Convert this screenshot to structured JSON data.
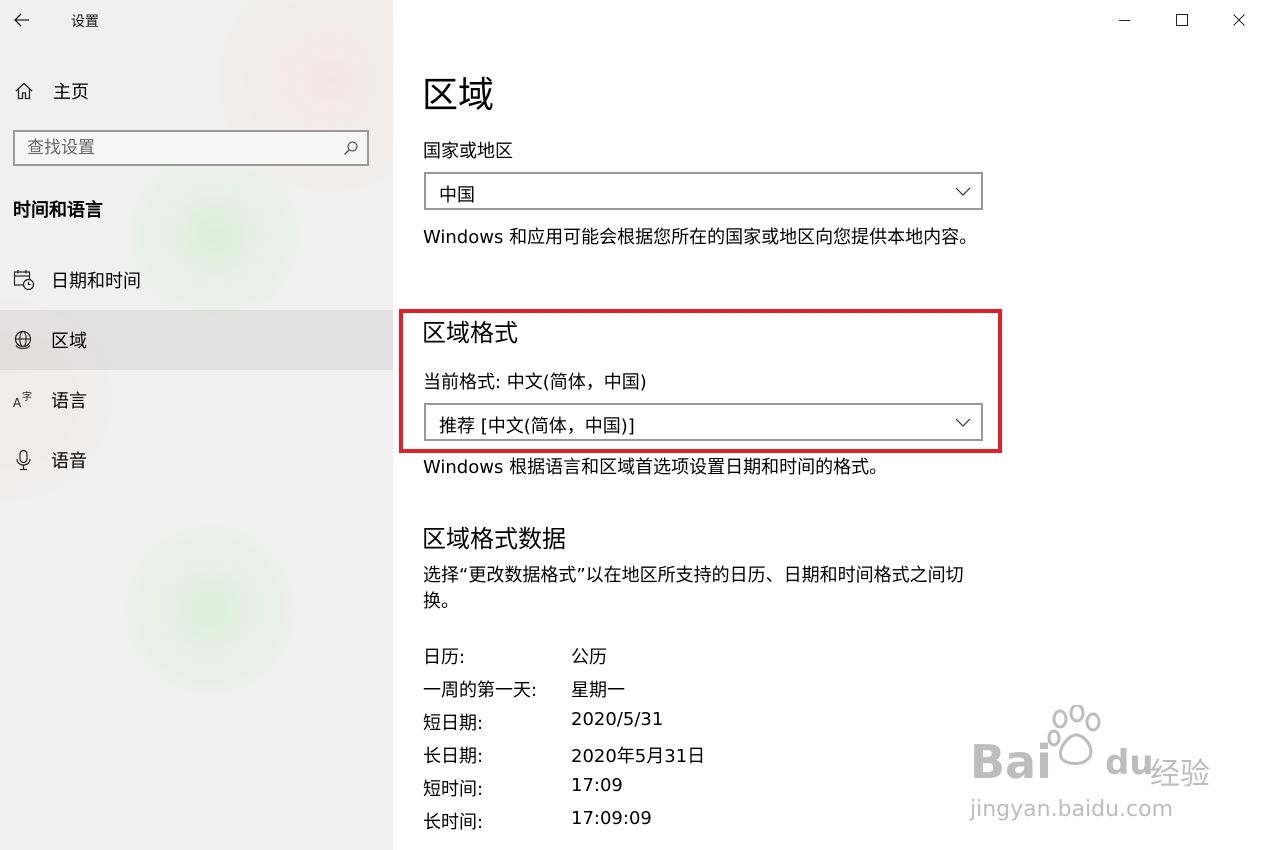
{
  "window": {
    "title": "设置",
    "controls": [
      "minimize-icon",
      "maximize-icon",
      "close-icon"
    ]
  },
  "sidebar": {
    "home_label": "主页",
    "search_placeholder": "查找设置",
    "section_heading": "时间和语言",
    "items": [
      {
        "label": "日期和时间",
        "icon": "calendar-clock-icon",
        "active": false
      },
      {
        "label": "区域",
        "icon": "globe-icon",
        "active": true
      },
      {
        "label": "语言",
        "icon": "language-icon",
        "active": false
      },
      {
        "label": "语音",
        "icon": "microphone-icon",
        "active": false
      }
    ]
  },
  "main": {
    "title": "区域",
    "country": {
      "label": "国家或地区",
      "value": "中国",
      "description": "Windows 和应用可能会根据您所在的国家或地区向您提供本地内容。"
    },
    "regional_format": {
      "heading": "区域格式",
      "current": "当前格式: 中文(简体，中国)",
      "value": "推荐 [中文(简体，中国)]",
      "description": "Windows 根据语言和区域首选项设置日期和时间的格式。"
    },
    "format_data": {
      "heading": "区域格式数据",
      "description": "选择“更改数据格式”以在地区所支持的日历、日期和时间格式之间切换。",
      "rows": [
        {
          "key": "日历:",
          "value": "公历"
        },
        {
          "key": "一周的第一天:",
          "value": "星期一"
        },
        {
          "key": "短日期:",
          "value": "2020/5/31"
        },
        {
          "key": "长日期:",
          "value": "2020年5月31日"
        },
        {
          "key": "短时间:",
          "value": "17:09"
        },
        {
          "key": "长时间:",
          "value": "17:09:09"
        }
      ]
    }
  },
  "highlight_color": "#e0202a",
  "watermark": {
    "brand": "Bai",
    "brand2": "du",
    "suffix": "经验",
    "url": "jingyan.baidu.com"
  }
}
